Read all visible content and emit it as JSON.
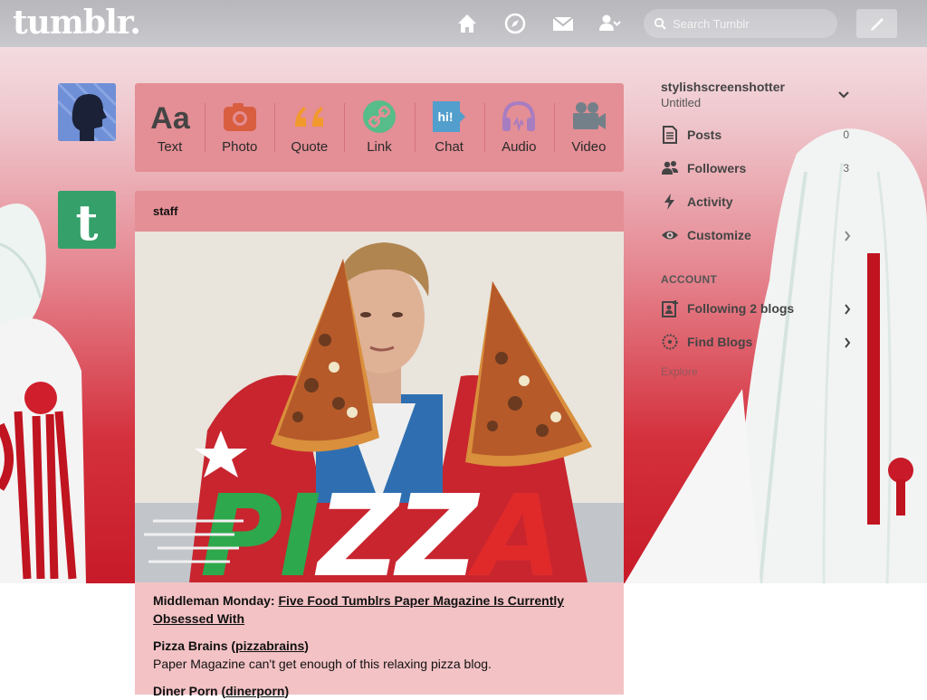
{
  "header": {
    "logo": "tumblr.",
    "search_placeholder": "Search Tumblr"
  },
  "composer": {
    "types": [
      {
        "label": "Text",
        "color": "#444444"
      },
      {
        "label": "Photo",
        "color": "#d95e40"
      },
      {
        "label": "Quote",
        "color": "#f2992e"
      },
      {
        "label": "Link",
        "color": "#56bc8a"
      },
      {
        "label": "Chat",
        "color": "#529ecc"
      },
      {
        "label": "Audio",
        "color": "#a77dc2"
      },
      {
        "label": "Video",
        "color": "#748089"
      }
    ]
  },
  "post": {
    "author": "staff",
    "image_text": "PIZZA",
    "body": {
      "p1_prefix": "Middleman Monday: ",
      "p1_link": "Five Food Tumblrs Paper Magazine Is Currently Obsessed With",
      "p2_title": "Pizza Brains (",
      "p2_link": "pizzabrains",
      "p2_close": ")",
      "p2_desc": "Paper Magazine can't get enough of this relaxing pizza blog.",
      "p3_title": "Diner Porn (",
      "p3_link": "dinerporn",
      "p3_close": ")"
    }
  },
  "sidebar": {
    "blog_name": "stylishscreenshotter",
    "blog_subtitle": "Untitled",
    "items": [
      {
        "label": "Posts",
        "count": "0"
      },
      {
        "label": "Followers",
        "count": "3"
      },
      {
        "label": "Activity"
      },
      {
        "label": "Customize"
      }
    ],
    "account_heading": "ACCOUNT",
    "account_items": [
      {
        "label": "Following 2 blogs"
      },
      {
        "label": "Find Blogs"
      }
    ],
    "explore": "Explore"
  },
  "colors": {
    "composer_bg": "#e48e95",
    "post_body_bg": "#f3c2c5",
    "staff_avatar": "#35a06a"
  }
}
